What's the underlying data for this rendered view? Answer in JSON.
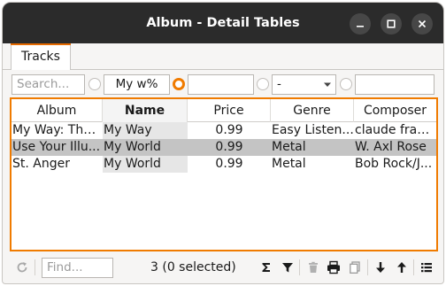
{
  "window": {
    "title": "Album - Detail Tables",
    "buttons": [
      "minimize",
      "maximize",
      "close"
    ]
  },
  "tabs": [
    {
      "label": "Tracks",
      "active": true
    }
  ],
  "filters": {
    "search_placeholder": "Search...",
    "name_filter_value": "My w%",
    "name_filter_active": true,
    "price_filter_value": "",
    "genre_select_value": "-",
    "composer_filter_value": ""
  },
  "table": {
    "columns": [
      {
        "label": "Album",
        "sorted": false
      },
      {
        "label": "Name",
        "sorted": true
      },
      {
        "label": "Price",
        "sorted": false
      },
      {
        "label": "Genre",
        "sorted": false
      },
      {
        "label": "Composer",
        "sorted": false
      }
    ],
    "rows": [
      {
        "album": "My Way: The...",
        "name": "My Way",
        "price": "0.99",
        "genre": "Easy Listen...",
        "composer": "claude fran...",
        "selected": false
      },
      {
        "album": "Use Your Illu...",
        "name": "My World",
        "price": "0.99",
        "genre": "Metal",
        "composer": "W. Axl Rose",
        "selected": true
      },
      {
        "album": "St. Anger",
        "name": "My World",
        "price": "0.99",
        "genre": "Metal",
        "composer": "Bob Rock/J...",
        "selected": false
      }
    ]
  },
  "statusbar": {
    "find_placeholder": "Find...",
    "count_text": "3 (0 selected)",
    "icons": [
      "refresh-icon",
      "sum-icon",
      "filter-icon",
      "delete-icon",
      "print-icon",
      "copy-icon",
      "move-down-icon",
      "move-up-icon",
      "menu-icon"
    ]
  },
  "colors": {
    "accent": "#f07b00",
    "titlebar": "#2b2b2b",
    "selection": "#c4c4c4"
  }
}
